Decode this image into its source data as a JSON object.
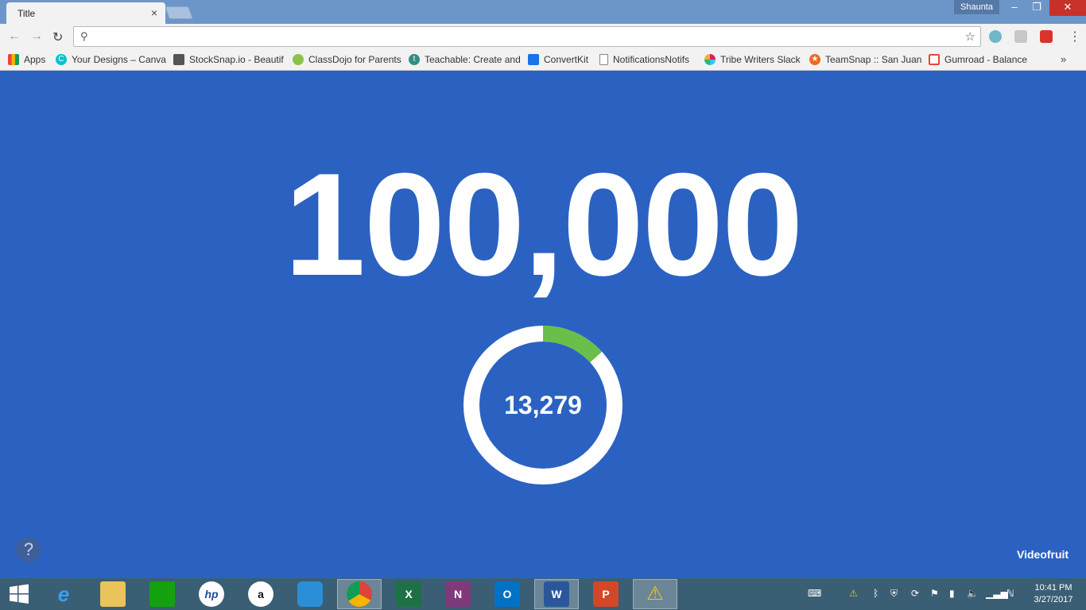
{
  "browser": {
    "tab_title": "Title",
    "tab_close": "×",
    "profile_name": "Shaunta",
    "window_controls": {
      "minimize": "–",
      "restore": "❐",
      "close": "✕"
    },
    "nav": {
      "back": "←",
      "forward": "→",
      "reload": "↻"
    },
    "omnibox": {
      "value": "",
      "search_icon": "⚲",
      "star_icon": "☆"
    },
    "menu": "⋮"
  },
  "bookmarks": [
    {
      "label": "Apps",
      "icon": "apps-grid-icon",
      "color": "#e8453c"
    },
    {
      "label": "Your Designs – Canva",
      "icon": "canva-icon",
      "color": "#00c4cc"
    },
    {
      "label": "StockSnap.io - Beautif",
      "icon": "camera-icon",
      "color": "#444444"
    },
    {
      "label": "ClassDojo for Parents",
      "icon": "classdojo-icon",
      "color": "#8bc34a"
    },
    {
      "label": "Teachable: Create and",
      "icon": "teachable-icon",
      "color": "#2f8f83"
    },
    {
      "label": "ConvertKit",
      "icon": "mail-icon",
      "color": "#1a73e8"
    },
    {
      "label": "NotificationsNotifs",
      "icon": "page-icon",
      "color": "#777777"
    },
    {
      "label": "Tribe Writers Slack",
      "icon": "slack-icon",
      "color": "#e01e5a"
    },
    {
      "label": "TeamSnap :: San Juan",
      "icon": "teamsnap-icon",
      "color": "#f26722"
    },
    {
      "label": "Gumroad - Balance",
      "icon": "gumroad-icon",
      "color": "#e8453c"
    }
  ],
  "bookmarks_more": "»",
  "main": {
    "goal_number": "100,000",
    "current_count": "13,279",
    "progress_fraction": 0.13279,
    "help_label": "?",
    "brand": "Videofruit"
  },
  "colors": {
    "page_bg": "#2b62c2",
    "ring_track": "#ffffff",
    "ring_progress": "#6abf4b"
  },
  "taskbar": {
    "clock_time": "10:41 PM",
    "clock_date": "3/27/2017"
  }
}
